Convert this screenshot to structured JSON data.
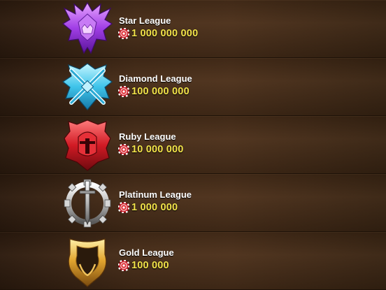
{
  "leagues": [
    {
      "name": "Star League",
      "requirement": "1 000 000 000",
      "icon": "star-league-emblem-icon",
      "color": "#a546e8"
    },
    {
      "name": "Diamond League",
      "requirement": "100 000 000",
      "icon": "diamond-league-emblem-icon",
      "color": "#4fd2f0"
    },
    {
      "name": "Ruby League",
      "requirement": "10 000 000",
      "icon": "ruby-league-emblem-icon",
      "color": "#d8212a"
    },
    {
      "name": "Platinum League",
      "requirement": "1 000 000",
      "icon": "platinum-league-emblem-icon",
      "color": "#c9c9c9"
    },
    {
      "name": "Gold League",
      "requirement": "100 000",
      "icon": "gold-league-emblem-icon",
      "color": "#e2a52f"
    }
  ],
  "currency_icon": "poker-chip-icon",
  "colors": {
    "amount_text": "#f3e34a",
    "chip": "#c8202a",
    "background": "#3a2414"
  }
}
